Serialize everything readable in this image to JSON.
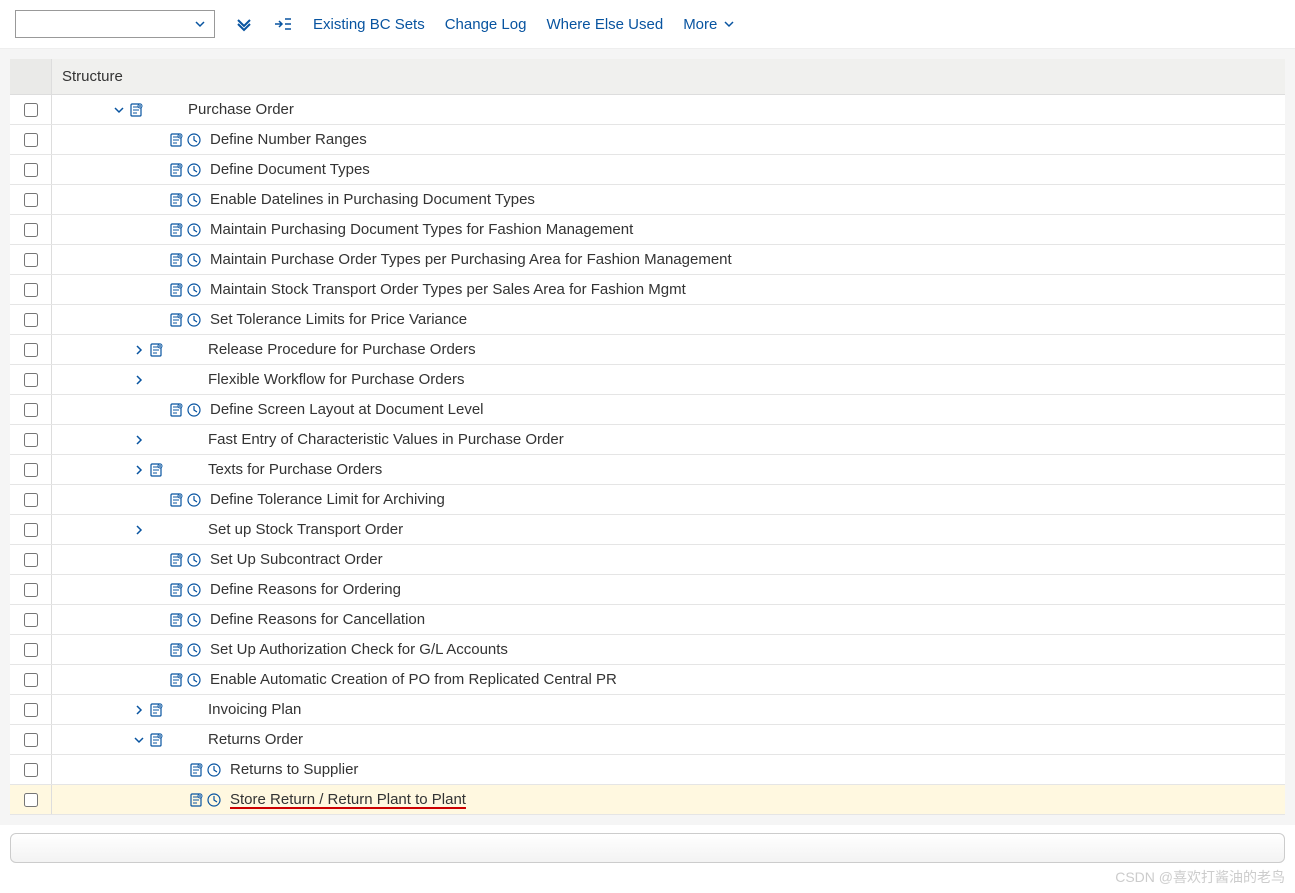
{
  "toolbar": {
    "existing_bc_sets": "Existing BC Sets",
    "change_log": "Change Log",
    "where_else_used": "Where Else Used",
    "more": "More"
  },
  "header": {
    "structure": "Structure"
  },
  "tree": [
    {
      "indent": 60,
      "exp": "down",
      "doc": true,
      "clock": false,
      "label": "Purchase Order"
    },
    {
      "indent": 100,
      "exp": "none",
      "doc": true,
      "clock": true,
      "label": "Define Number Ranges"
    },
    {
      "indent": 100,
      "exp": "none",
      "doc": true,
      "clock": true,
      "label": "Define Document Types"
    },
    {
      "indent": 100,
      "exp": "none",
      "doc": true,
      "clock": true,
      "label": "Enable Datelines in Purchasing Document Types"
    },
    {
      "indent": 100,
      "exp": "none",
      "doc": true,
      "clock": true,
      "label": "Maintain Purchasing Document Types for Fashion Management"
    },
    {
      "indent": 100,
      "exp": "none",
      "doc": true,
      "clock": true,
      "label": "Maintain Purchase Order Types per Purchasing Area for Fashion Management"
    },
    {
      "indent": 100,
      "exp": "none",
      "doc": true,
      "clock": true,
      "label": "Maintain Stock Transport Order Types per Sales Area for Fashion Mgmt"
    },
    {
      "indent": 100,
      "exp": "none",
      "doc": true,
      "clock": true,
      "label": "Set Tolerance Limits for Price Variance"
    },
    {
      "indent": 80,
      "exp": "right",
      "doc": true,
      "clock": false,
      "label": "Release Procedure for Purchase Orders"
    },
    {
      "indent": 80,
      "exp": "right",
      "doc": false,
      "clock": false,
      "label": "Flexible Workflow for Purchase Orders"
    },
    {
      "indent": 100,
      "exp": "none",
      "doc": true,
      "clock": true,
      "label": "Define Screen Layout at Document Level"
    },
    {
      "indent": 80,
      "exp": "right",
      "doc": false,
      "clock": false,
      "label": "Fast Entry of Characteristic Values in Purchase Order"
    },
    {
      "indent": 80,
      "exp": "right",
      "doc": true,
      "clock": false,
      "label": "Texts for Purchase Orders"
    },
    {
      "indent": 100,
      "exp": "none",
      "doc": true,
      "clock": true,
      "label": "Define Tolerance Limit for Archiving"
    },
    {
      "indent": 80,
      "exp": "right",
      "doc": false,
      "clock": false,
      "label": "Set up Stock Transport Order"
    },
    {
      "indent": 100,
      "exp": "none",
      "doc": true,
      "clock": true,
      "label": "Set Up Subcontract Order"
    },
    {
      "indent": 100,
      "exp": "none",
      "doc": true,
      "clock": true,
      "label": "Define Reasons for Ordering"
    },
    {
      "indent": 100,
      "exp": "none",
      "doc": true,
      "clock": true,
      "label": "Define Reasons for Cancellation"
    },
    {
      "indent": 100,
      "exp": "none",
      "doc": true,
      "clock": true,
      "label": "Set Up Authorization Check for G/L Accounts"
    },
    {
      "indent": 100,
      "exp": "none",
      "doc": true,
      "clock": true,
      "label": "Enable Automatic Creation of PO from Replicated Central PR"
    },
    {
      "indent": 80,
      "exp": "right",
      "doc": true,
      "clock": false,
      "label": "Invoicing Plan"
    },
    {
      "indent": 80,
      "exp": "down",
      "doc": true,
      "clock": false,
      "label": "Returns Order"
    },
    {
      "indent": 120,
      "exp": "none",
      "doc": true,
      "clock": true,
      "label": "Returns to Supplier"
    },
    {
      "indent": 120,
      "exp": "none",
      "doc": true,
      "clock": true,
      "label": "Store Return / Return Plant to Plant",
      "highlight": true,
      "selected": true
    }
  ],
  "watermark": "CSDN @喜欢打酱油的老鸟",
  "colors": {
    "link": "#0854a0",
    "highlight_bg": "#fff8e0",
    "underline": "#c00"
  }
}
